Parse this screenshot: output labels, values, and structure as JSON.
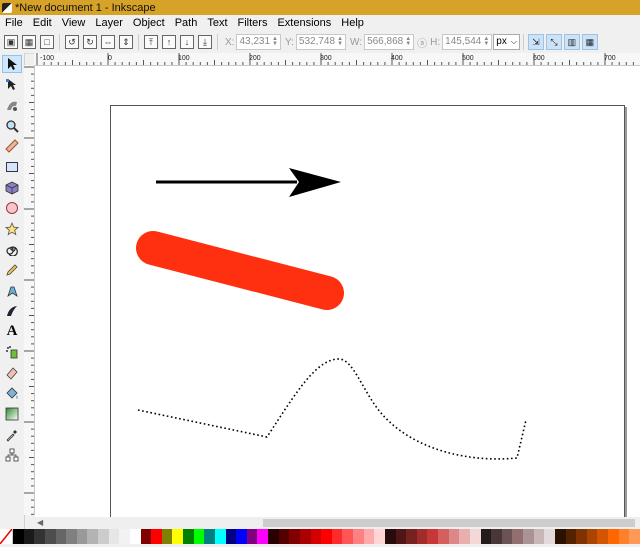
{
  "window": {
    "title": "*New document 1 - Inkscape"
  },
  "menu": [
    "File",
    "Edit",
    "View",
    "Layer",
    "Object",
    "Path",
    "Text",
    "Filters",
    "Extensions",
    "Help"
  ],
  "toolcontrols": {
    "x_label": "X:",
    "x_value": "43,231",
    "y_label": "Y:",
    "y_value": "532,748",
    "w_label": "W:",
    "w_value": "566,868",
    "h_label": "H:",
    "h_value": "145,544",
    "unit": "px"
  },
  "ruler_labels": [
    "-100",
    "0",
    "100",
    "200",
    "300",
    "400",
    "500",
    "600",
    "700"
  ],
  "tools": [
    {
      "name": "selector-tool",
      "icon": "arrow-icon"
    },
    {
      "name": "node-tool",
      "icon": "node-icon"
    },
    {
      "name": "tweak-tool",
      "icon": "tweak-icon"
    },
    {
      "name": "zoom-tool",
      "icon": "magnifier-icon"
    },
    {
      "name": "measure-tool",
      "icon": "ruler-icon"
    },
    {
      "name": "rectangle-tool",
      "icon": "rectangle-icon"
    },
    {
      "name": "3d-box-tool",
      "icon": "box3d-icon"
    },
    {
      "name": "ellipse-tool",
      "icon": "circle-icon"
    },
    {
      "name": "star-tool",
      "icon": "star-icon"
    },
    {
      "name": "spiral-tool",
      "icon": "spiral-icon"
    },
    {
      "name": "pencil-tool",
      "icon": "pencil-icon"
    },
    {
      "name": "pen-tool",
      "icon": "pen-icon"
    },
    {
      "name": "calligraphy-tool",
      "icon": "calligraphy-icon"
    },
    {
      "name": "text-tool",
      "icon": "text-icon"
    },
    {
      "name": "spray-tool",
      "icon": "spray-icon"
    },
    {
      "name": "eraser-tool",
      "icon": "eraser-icon"
    },
    {
      "name": "paint-bucket-tool",
      "icon": "bucket-icon"
    },
    {
      "name": "gradient-tool",
      "icon": "gradient-icon"
    },
    {
      "name": "dropper-tool",
      "icon": "dropper-icon"
    },
    {
      "name": "connector-tool",
      "icon": "connector-icon"
    }
  ],
  "canvas_colors": {
    "arrow": "#000000",
    "stroke_bar": "#ff3010",
    "dotted_path": "#000000"
  },
  "palette": [
    "#000000",
    "#1a1a1a",
    "#333333",
    "#4d4d4d",
    "#666666",
    "#808080",
    "#999999",
    "#b3b3b3",
    "#cccccc",
    "#e6e6e6",
    "#f2f2f2",
    "#ffffff",
    "#800000",
    "#ff0000",
    "#808000",
    "#ffff00",
    "#008000",
    "#00ff00",
    "#008080",
    "#00ffff",
    "#000080",
    "#0000ff",
    "#800080",
    "#ff00ff",
    "#2b0000",
    "#550000",
    "#800000",
    "#aa0000",
    "#d40000",
    "#ff0000",
    "#ff2a2a",
    "#ff5555",
    "#ff8080",
    "#ffaaaa",
    "#ffd5d5",
    "#280b0b",
    "#501616",
    "#782121",
    "#a02c2c",
    "#c83737",
    "#d35f5f",
    "#de8787",
    "#e9afaf",
    "#f4d7d7",
    "#241c1c",
    "#483737",
    "#6c5353",
    "#916f6f",
    "#ac9393",
    "#c8b7b7",
    "#e3dbdb",
    "#2b1100",
    "#552200",
    "#803300",
    "#aa4400",
    "#d45500",
    "#ff6600",
    "#ff7f2a",
    "#ff9955"
  ]
}
